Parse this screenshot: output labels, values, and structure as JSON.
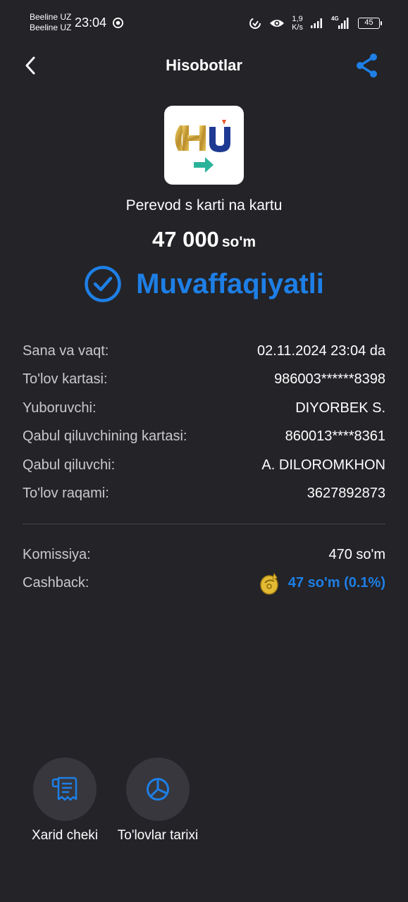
{
  "status_bar": {
    "carrier1": "Beeline UZ",
    "carrier2": "Beeline UZ",
    "time": "23:04",
    "speed_value": "1,9",
    "speed_unit": "K/s",
    "network": "4G",
    "battery": "45"
  },
  "header": {
    "title": "Hisobotlar",
    "back_icon": "chevron-left-icon",
    "share_icon": "share-icon"
  },
  "transfer": {
    "title": "Perevod s karti na kartu",
    "amount": "47 000",
    "currency": "so'm",
    "status": "Muvaffaqiyatli"
  },
  "details": [
    {
      "label": "Sana va vaqt:",
      "value": "02.11.2024 23:04 da"
    },
    {
      "label": "To'lov kartasi:",
      "value": "986003******8398"
    },
    {
      "label": "Yuboruvchi:",
      "value": "DIYORBEK S."
    },
    {
      "label": "Qabul qiluvchining kartasi:",
      "value": "860013****8361"
    },
    {
      "label": "Qabul qiluvchi:",
      "value": "A. DILOROMKHON"
    },
    {
      "label": "To'lov raqami:",
      "value": "3627892873"
    }
  ],
  "fees": {
    "commission_label": "Komissiya:",
    "commission_value": "470 so'm",
    "cashback_label": "Cashback:",
    "cashback_value": "47 so'm (0.1%)"
  },
  "actions": [
    {
      "label": "Xarid cheki",
      "icon": "receipt-icon"
    },
    {
      "label": "To'lovlar tarixi",
      "icon": "pie-chart-icon"
    }
  ],
  "colors": {
    "background": "#232328",
    "accent": "#1e7fe6",
    "teal": "#2bb39a",
    "gold": "#e3bb33"
  }
}
